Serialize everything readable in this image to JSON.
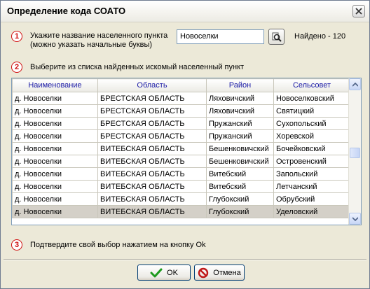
{
  "window": {
    "title": "Определение кода СОАТО"
  },
  "step1": {
    "num": "1",
    "line1": "Укажите название населенного пункта",
    "line2": "(можно указать начальные буквы)",
    "search_value": "Новоселки",
    "found_label": "Найдено - 120"
  },
  "step2": {
    "num": "2",
    "text": "Выберите из списка найденных искомый населенный пункт"
  },
  "grid": {
    "columns": [
      "Наименование",
      "Область",
      "Район",
      "Сельсовет"
    ],
    "rows": [
      [
        "д. Новоселки",
        "БРЕСТСКАЯ ОБЛАСТЬ",
        "Ляховичский",
        "Новоселковский"
      ],
      [
        "д. Новоселки",
        "БРЕСТСКАЯ ОБЛАСТЬ",
        "Ляховичский",
        "Святицкий"
      ],
      [
        "д. Новоселки",
        "БРЕСТСКАЯ ОБЛАСТЬ",
        "Пружанский",
        "Сухопольский"
      ],
      [
        "д. Новоселки",
        "БРЕСТСКАЯ ОБЛАСТЬ",
        "Пружанский",
        "Хоревской"
      ],
      [
        "д. Новоселки",
        "ВИТЕБСКАЯ ОБЛАСТЬ",
        "Бешенковичский",
        "Бочейковский"
      ],
      [
        "д. Новоселки",
        "ВИТЕБСКАЯ ОБЛАСТЬ",
        "Бешенковичский",
        "Островенский"
      ],
      [
        "д. Новоселки",
        "ВИТЕБСКАЯ ОБЛАСТЬ",
        "Витебский",
        "Запольский"
      ],
      [
        "д. Новоселки",
        "ВИТЕБСКАЯ ОБЛАСТЬ",
        "Витебский",
        "Летчанский"
      ],
      [
        "д. Новоселки",
        "ВИТЕБСКАЯ ОБЛАСТЬ",
        "Глубокский",
        "Обрубский"
      ],
      [
        "д. Новоселки",
        "ВИТЕБСКАЯ ОБЛАСТЬ",
        "Глубокский",
        "Уделовский"
      ]
    ],
    "selected_row": 9
  },
  "step3": {
    "num": "3",
    "text": "Подтвердите свой выбор нажатием на кнопку Ok"
  },
  "buttons": {
    "ok": "OK",
    "cancel": "Отмена"
  },
  "colors": {
    "accent_red": "#d01010",
    "header_text": "#1a1aa6",
    "ok_check": "#1d9a1d"
  },
  "icons": {
    "close": "close-icon",
    "search": "magnifier-icon",
    "ok": "checkmark-icon",
    "cancel": "no-entry-icon"
  }
}
